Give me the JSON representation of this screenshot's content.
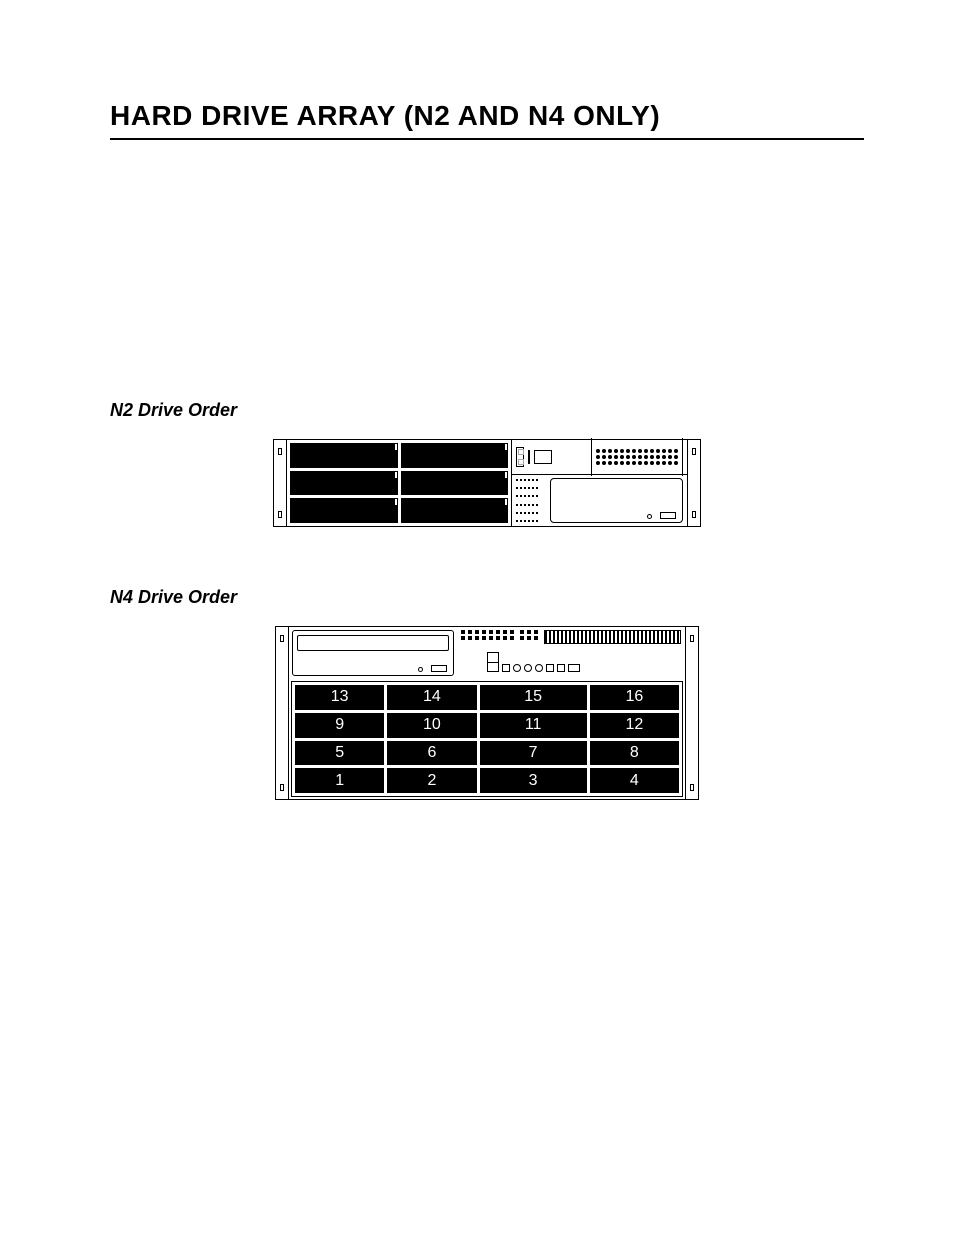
{
  "title": "HARD DRIVE ARRAY (N2 AND N4 ONLY)",
  "n2": {
    "heading": "N2 Drive Order"
  },
  "n4": {
    "heading": "N4 Drive Order",
    "rows": [
      [
        "13",
        "14",
        "15",
        "16"
      ],
      [
        "9",
        "10",
        "11",
        "12"
      ],
      [
        "5",
        "6",
        "7",
        "8"
      ],
      [
        "1",
        "2",
        "3",
        "4"
      ]
    ]
  }
}
